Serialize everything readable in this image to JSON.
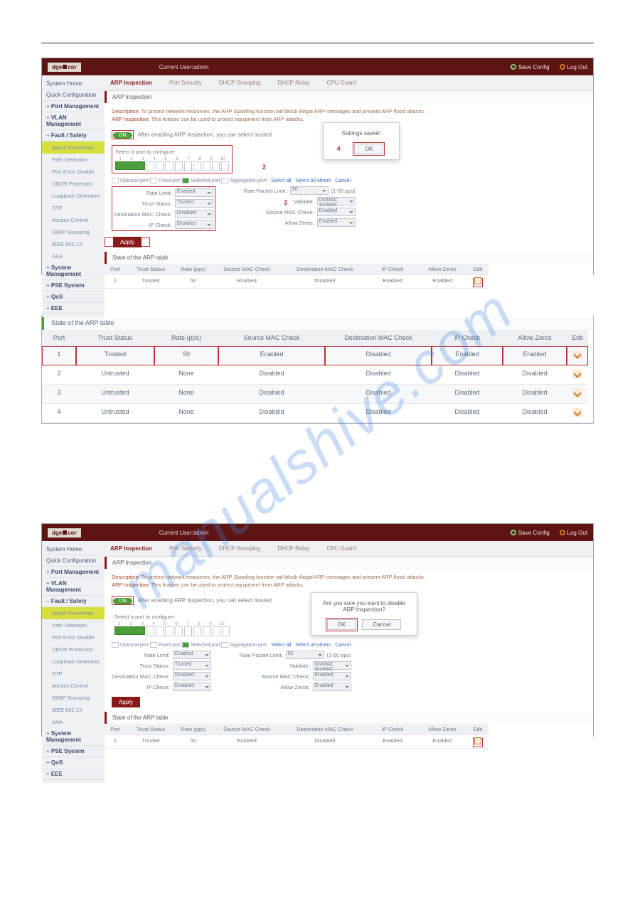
{
  "watermark": "manualshive.com",
  "header": {
    "brand_prefix": "dge",
    "brand_suffix": "cor",
    "current_user": "Current User:admin",
    "save_config": "Save Config",
    "log_out": "Log Out"
  },
  "tabs": [
    "ARP Inspection",
    "Port Security",
    "DHCP Snooping",
    "DHCP Relay",
    "CPU Guard"
  ],
  "sidebar": {
    "items": [
      {
        "label": "System Home",
        "type": "plain"
      },
      {
        "label": "Quick Configuration",
        "type": "plain"
      },
      {
        "label": "Port Management",
        "type": "expand bold"
      },
      {
        "label": "VLAN Management",
        "type": "expand bold"
      },
      {
        "label": "Fault / Safety",
        "type": "collapse bold"
      },
      {
        "label": "Attack Prevention",
        "type": "sub active"
      },
      {
        "label": "Path Detection",
        "type": "sub"
      },
      {
        "label": "Port Error Disable",
        "type": "sub"
      },
      {
        "label": "DDOS Protection",
        "type": "sub"
      },
      {
        "label": "Loopback Detection",
        "type": "sub"
      },
      {
        "label": "STP",
        "type": "sub"
      },
      {
        "label": "Access Control",
        "type": "sub"
      },
      {
        "label": "IGMP Snooping",
        "type": "sub"
      },
      {
        "label": "IEEE 802.1X",
        "type": "sub"
      },
      {
        "label": "AAA",
        "type": "sub"
      },
      {
        "label": "System Management",
        "type": "expand bold"
      },
      {
        "label": "PSE System",
        "type": "expand bold"
      },
      {
        "label": "QoS",
        "type": "expand bold"
      },
      {
        "label": "EEE",
        "type": "expand bold"
      }
    ]
  },
  "arp_panel": {
    "title": "ARP Inspection",
    "desc1_label": "Description: ",
    "desc1": "To protect network resources, the ARP Spoofing function will block illegal ARP messages and prevent ARP flood attacks.",
    "desc2_label": "ARP Inspection: ",
    "desc2": "This feature can be used to protect equipment from ARP attacks.",
    "toggle": "ON",
    "hint": "After enabling ARP Inspection, you can select trusted",
    "select_port": "Select a port to configure:",
    "port_count": 10,
    "selected_port": 1,
    "legend": {
      "optional": "Optional port",
      "fixed": "Fixed port",
      "selected": "Selected port",
      "agg": "Aggregation port",
      "links": [
        "Select all",
        "Select all others",
        "Cancel"
      ]
    },
    "form_left": [
      {
        "l": "Rate Limit:",
        "v": "Enabled"
      },
      {
        "l": "Trust Status:",
        "v": "Trusted"
      },
      {
        "l": "Destination MAC Check:",
        "v": "Disabled"
      },
      {
        "l": "IP Check:",
        "v": "Disabled"
      }
    ],
    "form_right": [
      {
        "l": "Rate Packet Limit:",
        "v": "50",
        "suffix": "(1-50 pps)"
      },
      {
        "l": "Validate:",
        "v": "DstMAC   SrcMAC"
      },
      {
        "l": "Source MAC Check:",
        "v": "Enabled"
      },
      {
        "l": "Allow Zeros:",
        "v": "Enabled"
      }
    ],
    "apply": "Apply",
    "tbl_title": "State of the ARP table",
    "tbl_head": [
      "Port",
      "Trust Status",
      "Rate (pps)",
      "Source MAC Check",
      "Destination MAC Check",
      "IP Check",
      "Allow Zeros",
      "Edit"
    ],
    "tbl_row": [
      "1",
      "Trusted",
      "50",
      "Enabled",
      "Disabled",
      "Enabled",
      "Enabled",
      ""
    ],
    "callouts": {
      "c2": "2",
      "c3": "3",
      "c4": "4"
    }
  },
  "modal1": {
    "msg": "Settings saved!",
    "ok": "OK"
  },
  "arp_table_big": {
    "caption": "State of the ARP table",
    "head": [
      "Port",
      "Trust Status",
      "Rate (pps)",
      "Source MAC Check",
      "Destination MAC Check",
      "IP Check",
      "Allow Zeros",
      "Edit"
    ],
    "rows": [
      [
        "1",
        "Trusted",
        "50",
        "Enabled",
        "Disabled",
        "Enabled",
        "Enabled"
      ],
      [
        "2",
        "Untrusted",
        "None",
        "Disabled",
        "Disabled",
        "Disabled",
        "Disabled"
      ],
      [
        "3",
        "Untrusted",
        "None",
        "Disabled",
        "Disabled",
        "Disabled",
        "Disabled"
      ],
      [
        "4",
        "Untrusted",
        "None",
        "Disabled",
        "Disabled",
        "Disabled",
        "Disabled"
      ]
    ]
  },
  "modal2": {
    "msg": "Are you sure you want to disable ARP Inspection?",
    "ok": "OK",
    "cancel": "Cancel"
  }
}
